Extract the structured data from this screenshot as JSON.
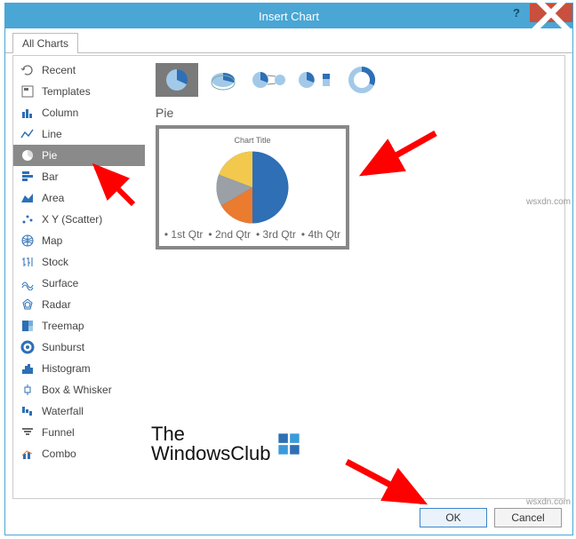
{
  "window": {
    "title": "Insert Chart"
  },
  "tabs": {
    "all_charts": "All Charts"
  },
  "sidebar": {
    "items": [
      {
        "label": "Recent"
      },
      {
        "label": "Templates"
      },
      {
        "label": "Column"
      },
      {
        "label": "Line"
      },
      {
        "label": "Pie"
      },
      {
        "label": "Bar"
      },
      {
        "label": "Area"
      },
      {
        "label": "X Y (Scatter)"
      },
      {
        "label": "Map"
      },
      {
        "label": "Stock"
      },
      {
        "label": "Surface"
      },
      {
        "label": "Radar"
      },
      {
        "label": "Treemap"
      },
      {
        "label": "Sunburst"
      },
      {
        "label": "Histogram"
      },
      {
        "label": "Box & Whisker"
      },
      {
        "label": "Waterfall"
      },
      {
        "label": "Funnel"
      },
      {
        "label": "Combo"
      }
    ],
    "selected_index": 4
  },
  "subtypes": {
    "selected_index": 0,
    "label": "Pie"
  },
  "preview": {
    "chart_title": "Chart Title",
    "legend": [
      "1st Qtr",
      "2nd Qtr",
      "3rd Qtr",
      "4th Qtr"
    ]
  },
  "buttons": {
    "ok": "OK",
    "cancel": "Cancel"
  },
  "watermark": {
    "line1": "The",
    "line2": "WindowsClub"
  },
  "credit": "wsxdn.com",
  "chart_data": {
    "type": "pie",
    "title": "Chart Title",
    "categories": [
      "1st Qtr",
      "2nd Qtr",
      "3rd Qtr",
      "4th Qtr"
    ],
    "values": [
      58,
      23,
      10,
      9
    ],
    "colors": [
      "#2e6fb5",
      "#ea7b2f",
      "#9aa0a6",
      "#f2c94c"
    ]
  }
}
